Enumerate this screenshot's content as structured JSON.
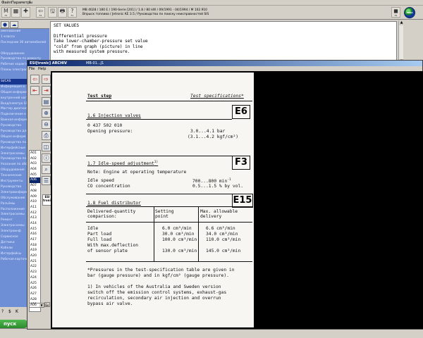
{
  "menubar": {
    "file": "Файл",
    "params": "Параметры",
    "help": "?"
  },
  "toolbar": {
    "buttons": [
      {
        "icon": "M",
        "label": "F2"
      },
      {
        "icon": "▦",
        "label": ""
      },
      {
        "icon": "✚",
        "label": ""
      },
      {
        "icon": "⇦",
        "label": "F4"
      },
      {
        "icon": "🖫",
        "label": ""
      },
      {
        "icon": "🖶",
        "label": ""
      },
      {
        "icon": "?",
        "label": "F1"
      },
      {
        "icon": "◼",
        "label": "F6"
      }
    ]
  },
  "vehicle_info": {
    "line1": "MB 4028 / 180 E / 190-Serie [201] / 1.8 / 80 kW / 09/1991 - 04/1994 / M 102.910",
    "line2": "Впрыск топлива / Jetronic KE 3.5 / Руководство по поиску неисправностей SIS"
  },
  "logo_text": "ASRA",
  "left_tabs": [
    "●",
    "☁"
  ],
  "tree": {
    "items": [
      "именования",
      "1 класса",
      "Последние 30 автомобилей",
      "",
      "Оборудование",
      "Руководства по ремонту",
      "Рабочие характеристики",
      "Планы электросхем",
      "",
      "SI/CAS",
      "Информация о",
      "Общая информа",
      "внутренней нагр",
      "Вход/электро SIT",
      "Мастер диагностики",
      "Подключение к",
      "Важная информ",
      "Руководство",
      "Руководство для",
      "Общая информ",
      "Руководство по",
      "Интерфейсные",
      "Электросхемы",
      "Руководство по",
      "Указания по обсл",
      "Оборудование",
      "Технические",
      "Инструменты",
      "Руководства",
      "Электроинформац",
      "Обслуживание",
      "Разъёмы",
      "Расположение",
      "Электросхемы",
      "Ремонт",
      "Электросхемы",
      "Электроинф",
      "Сервисное",
      "Датчики",
      "Кабели",
      "Интерфейсы",
      "Рабочая карточка"
    ],
    "selected_index": 9
  },
  "left_bottom": {
    "q": "?",
    "s": "$",
    "k": "K"
  },
  "start_label": "пуск",
  "text_panel": {
    "lines": [
      "SET VALUES",
      "",
      "Differential pressure",
      "Take lower-chamber-pressure set value",
      "\"cold\" from graph (picture) in line",
      "with measured system pressure.",
      "",
      ""
    ]
  },
  "child_window": {
    "title": "ESI[tronic] ARCHIV",
    "doc_title": "MB-01...J1",
    "menu": [
      "File",
      "Help"
    ]
  },
  "a_list": {
    "items": [
      "A01",
      "A02",
      "A03",
      "A04",
      "A05",
      "A06",
      "A07",
      "A08",
      "A09",
      "A10",
      "A11",
      "A12",
      "A13",
      "A14",
      "A15",
      "A16",
      "A17",
      "A18",
      "A19",
      "A20",
      "A21",
      "A22",
      "A23",
      "A24",
      "A25",
      "A26",
      "A27",
      "A28",
      "A29"
    ],
    "selected_index": 5,
    "select_value": "A06",
    "small_btn": "Бк"
  },
  "esi_icon": "ESI tronic",
  "document": {
    "header_left": "Test step",
    "header_right": "Test specifications*",
    "section1": {
      "title": "1.6  Injection valves",
      "code": "E6",
      "part": "0 437 502 010",
      "label": "Opening pressure:",
      "value1": "3.0...4.1 bar",
      "value2": "(3.1...4.2 kgf/cm²)"
    },
    "section2": {
      "title": "1.7  Idle-speed adjustment",
      "sup": "1)",
      "code": "F3",
      "note": "Note: Engine at operating temperature",
      "row1_label": "Idle speed",
      "row1_value": "700...800 min",
      "row1_sup": "-1",
      "row2_label": "CO concentration",
      "row2_value": "0.5...1.5 % by vol."
    },
    "section3": {
      "title": "1.8  Fuel distributor",
      "code": "E15",
      "col1_header": [
        "Delivered-quantity",
        "comparison:"
      ],
      "col2_header": [
        "Setting",
        "point"
      ],
      "col3_header": [
        "Max. allowable",
        "delivery"
      ],
      "rows": [
        {
          "label": "Idle",
          "setting": "6.0 cm³/min",
          "max": "6.6 cm³/min"
        },
        {
          "label": "Part load",
          "setting": "30.0 cm³/min",
          "max": "34.0 cm³/min"
        },
        {
          "label": "Full load",
          "setting": "100.0 cm³/min",
          "max": "110.0 cm³/min"
        },
        {
          "label": "With max.deflection",
          "setting": "",
          "max": ""
        },
        {
          "label": "of sensor plate",
          "setting": "130.0 cm³/min",
          "max": "145.0 cm³/min"
        }
      ]
    },
    "footnote_star": [
      "*Pressures in the test-specification table are given in",
      "bar (gauge pressure) and in kgf/cm² (gauge pressure)."
    ],
    "footnote_1": [
      "1) In vehicles of the Australia and Sweden version",
      "   switch off the emission control systems, exhaust-gas",
      "   recirculation, secondary air injection and overrun",
      "   bypass air valve."
    ]
  }
}
